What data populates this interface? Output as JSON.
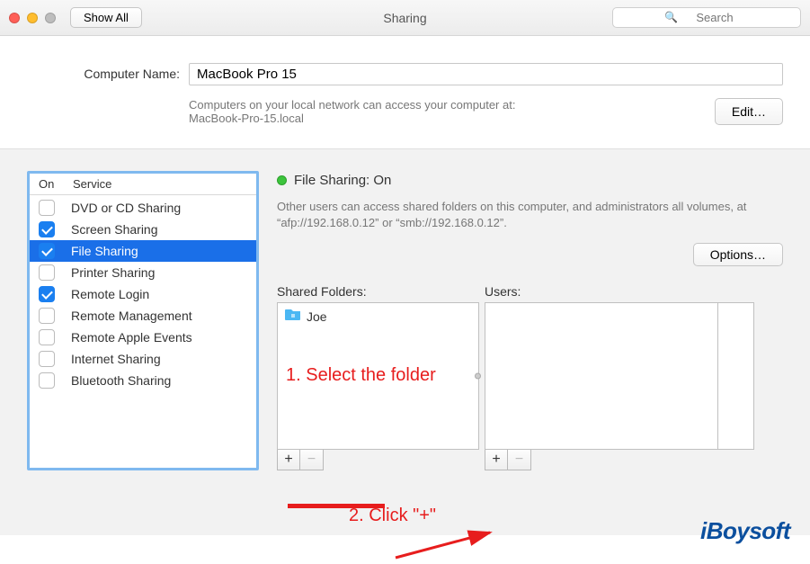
{
  "titlebar": {
    "show_all": "Show All",
    "title": "Sharing",
    "search_placeholder": "Search"
  },
  "computer_name": {
    "label": "Computer Name:",
    "value": "MacBook Pro 15",
    "subtext_line1": "Computers on your local network can access your computer at:",
    "subtext_line2": "MacBook-Pro-15.local",
    "edit": "Edit…"
  },
  "services": {
    "header_on": "On",
    "header_service": "Service",
    "items": [
      {
        "label": "DVD or CD Sharing",
        "checked": false,
        "selected": false
      },
      {
        "label": "Screen Sharing",
        "checked": true,
        "selected": false
      },
      {
        "label": "File Sharing",
        "checked": true,
        "selected": true
      },
      {
        "label": "Printer Sharing",
        "checked": false,
        "selected": false
      },
      {
        "label": "Remote Login",
        "checked": true,
        "selected": false
      },
      {
        "label": "Remote Management",
        "checked": false,
        "selected": false
      },
      {
        "label": "Remote Apple Events",
        "checked": false,
        "selected": false
      },
      {
        "label": "Internet Sharing",
        "checked": false,
        "selected": false
      },
      {
        "label": "Bluetooth Sharing",
        "checked": false,
        "selected": false
      }
    ]
  },
  "status": {
    "title": "File Sharing: On",
    "description": "Other users can access shared folders on this computer, and administrators all volumes, at “afp://192.168.0.12” or “smb://192.168.0.12”.",
    "options": "Options…"
  },
  "shared": {
    "label": "Shared Folders:",
    "folders": [
      {
        "name": "Joe"
      }
    ]
  },
  "users": {
    "label": "Users:"
  },
  "annotations": {
    "step1": "1. Select the folder",
    "step2": "2. Click \"+\""
  },
  "watermark": "iBoysoft"
}
